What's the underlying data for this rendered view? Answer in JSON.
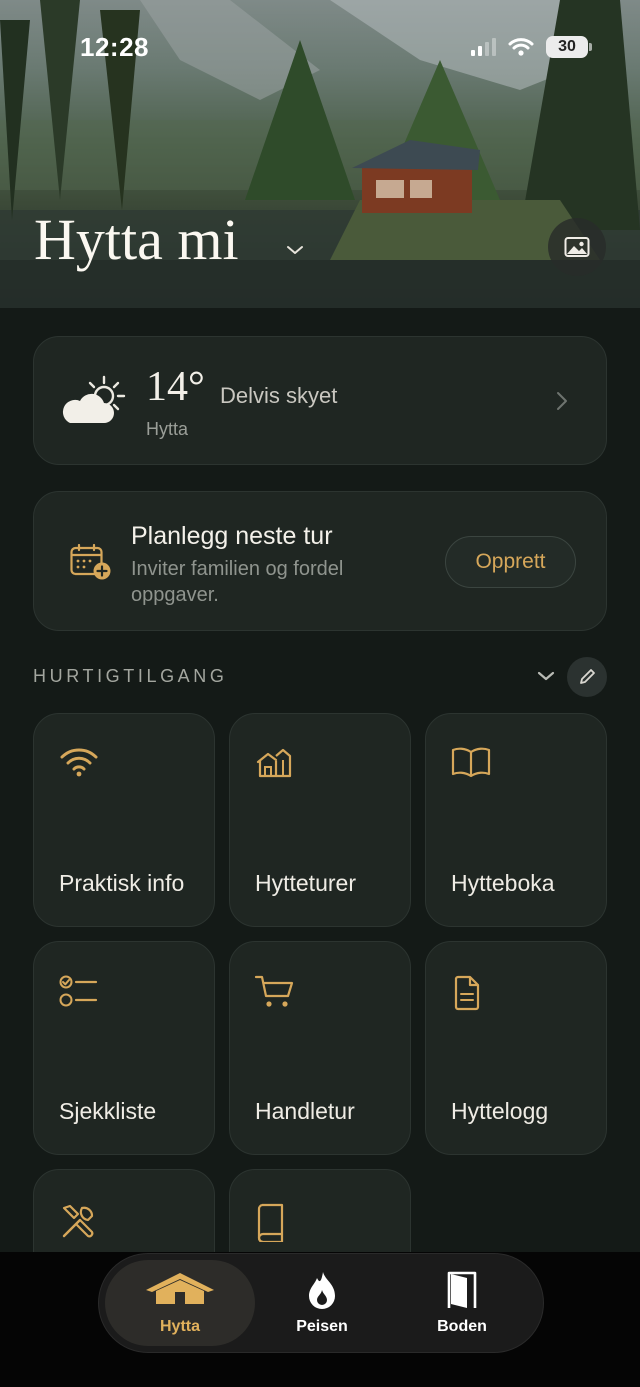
{
  "status_bar": {
    "time": "12:28",
    "battery": "30"
  },
  "header": {
    "title": "Hytta mi",
    "chevron_icon": "chevron-down-icon",
    "photo_icon": "image-icon"
  },
  "weather": {
    "icon": "partly-cloudy-icon",
    "temperature": "14°",
    "condition": "Delvis skyet",
    "location": "Hytta"
  },
  "plan": {
    "icon": "calendar-add-icon",
    "title": "Planlegg neste tur",
    "subtitle": "Inviter familien og fordel oppgaver.",
    "button_label": "Opprett"
  },
  "quick_access": {
    "heading": "HURTIGTILGANG",
    "tiles": [
      {
        "label": "Praktisk info",
        "icon": "wifi-icon"
      },
      {
        "label": "Hytteturer",
        "icon": "houses-icon"
      },
      {
        "label": "Hytteboka",
        "icon": "open-book-icon"
      },
      {
        "label": "Sjekkliste",
        "icon": "checklist-icon"
      },
      {
        "label": "Handletur",
        "icon": "shopping-cart-icon"
      },
      {
        "label": "Hyttelogg",
        "icon": "document-icon"
      },
      {
        "label": "",
        "icon": "tools-icon"
      },
      {
        "label": "",
        "icon": "book-icon"
      }
    ]
  },
  "tabbar": {
    "tabs": [
      {
        "label": "Hytta",
        "icon": "cabin-icon",
        "active": true
      },
      {
        "label": "Peisen",
        "icon": "flame-icon",
        "active": false
      },
      {
        "label": "Boden",
        "icon": "door-icon",
        "active": false
      }
    ]
  },
  "colors": {
    "accent": "#d6a75a",
    "card": "#1f2622",
    "background": "#141a17"
  }
}
